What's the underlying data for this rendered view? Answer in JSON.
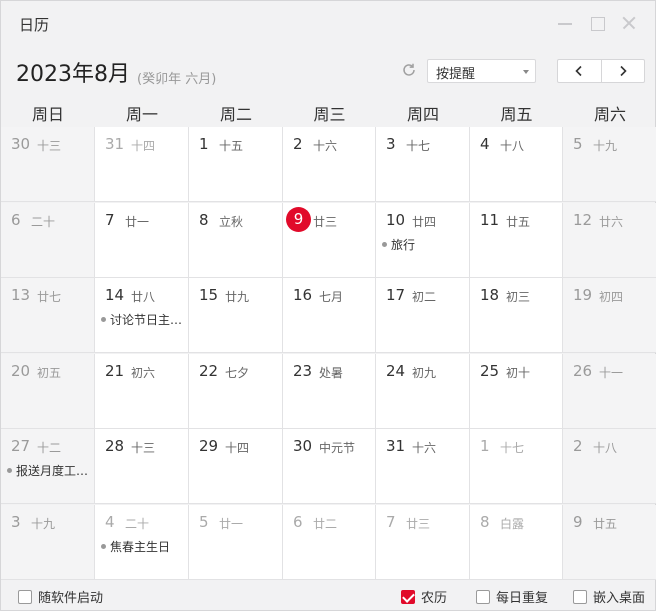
{
  "window": {
    "title": "日历"
  },
  "header": {
    "month_title": "2023年8月",
    "lunar_sub": "(癸卯年 六月)",
    "remind_select": "按提醒",
    "prev_icon": "chevron-left-icon",
    "next_icon": "chevron-right-icon"
  },
  "weekdays": [
    "周日",
    "周一",
    "周二",
    "周三",
    "周四",
    "周五",
    "周六"
  ],
  "weeks": [
    [
      {
        "day": "30",
        "lunar": "十三",
        "dim": true
      },
      {
        "day": "31",
        "lunar": "十四",
        "dim": true
      },
      {
        "day": "1",
        "lunar": "十五"
      },
      {
        "day": "2",
        "lunar": "十六"
      },
      {
        "day": "3",
        "lunar": "十七"
      },
      {
        "day": "4",
        "lunar": "十八"
      },
      {
        "day": "5",
        "lunar": "十九"
      }
    ],
    [
      {
        "day": "6",
        "lunar": "二十"
      },
      {
        "day": "7",
        "lunar": "廿一"
      },
      {
        "day": "8",
        "lunar": "立秋"
      },
      {
        "day": "9",
        "lunar": "廿三",
        "today": true
      },
      {
        "day": "10",
        "lunar": "廿四",
        "event": "旅行"
      },
      {
        "day": "11",
        "lunar": "廿五"
      },
      {
        "day": "12",
        "lunar": "廿六"
      }
    ],
    [
      {
        "day": "13",
        "lunar": "廿七"
      },
      {
        "day": "14",
        "lunar": "廿八",
        "event": "讨论节日主…"
      },
      {
        "day": "15",
        "lunar": "廿九"
      },
      {
        "day": "16",
        "lunar": "七月"
      },
      {
        "day": "17",
        "lunar": "初二"
      },
      {
        "day": "18",
        "lunar": "初三"
      },
      {
        "day": "19",
        "lunar": "初四"
      }
    ],
    [
      {
        "day": "20",
        "lunar": "初五"
      },
      {
        "day": "21",
        "lunar": "初六"
      },
      {
        "day": "22",
        "lunar": "七夕"
      },
      {
        "day": "23",
        "lunar": "处暑"
      },
      {
        "day": "24",
        "lunar": "初九"
      },
      {
        "day": "25",
        "lunar": "初十"
      },
      {
        "day": "26",
        "lunar": "十一"
      }
    ],
    [
      {
        "day": "27",
        "lunar": "十二",
        "event": "报送月度工…"
      },
      {
        "day": "28",
        "lunar": "十三"
      },
      {
        "day": "29",
        "lunar": "十四"
      },
      {
        "day": "30",
        "lunar": "中元节"
      },
      {
        "day": "31",
        "lunar": "十六"
      },
      {
        "day": "1",
        "lunar": "十七",
        "dim": true
      },
      {
        "day": "2",
        "lunar": "十八",
        "dim": true
      }
    ],
    [
      {
        "day": "3",
        "lunar": "十九",
        "dim": true
      },
      {
        "day": "4",
        "lunar": "二十",
        "dim": true,
        "event": "焦春主生日"
      },
      {
        "day": "5",
        "lunar": "廿一",
        "dim": true
      },
      {
        "day": "6",
        "lunar": "廿二",
        "dim": true
      },
      {
        "day": "7",
        "lunar": "廿三",
        "dim": true
      },
      {
        "day": "8",
        "lunar": "白露",
        "dim": true
      },
      {
        "day": "9",
        "lunar": "廿五",
        "dim": true
      }
    ]
  ],
  "footer": {
    "autostart": {
      "label": "随软件启动",
      "checked": false
    },
    "lunar": {
      "label": "农历",
      "checked": true
    },
    "daily": {
      "label": "每日重复",
      "checked": false
    },
    "embed": {
      "label": "嵌入桌面",
      "checked": false
    }
  },
  "colors": {
    "accent": "#e10a2a"
  }
}
